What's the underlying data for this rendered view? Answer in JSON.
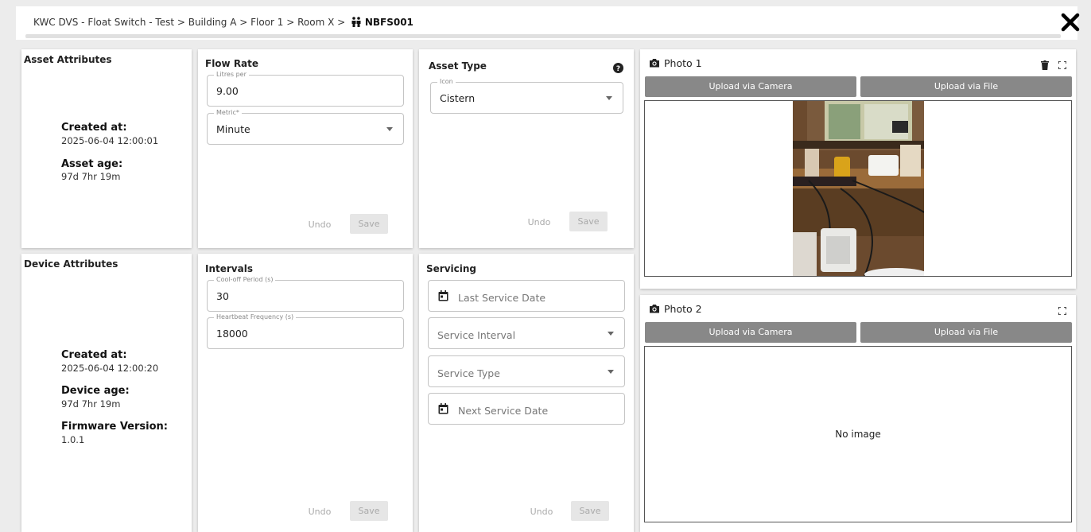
{
  "header": {
    "breadcrumb_path": "KWC DVS - Float Switch - Test > Building A > Floor 1 > Room X >",
    "device_id": "NBFS001",
    "close_icon": "close-icon",
    "device_icon": "people-icon"
  },
  "asset_attributes": {
    "title": "Asset Attributes",
    "created_label": "Created at:",
    "created_value": "2025-06-04 12:00:01",
    "age_label": "Asset age:",
    "age_value": "97d 7hr 19m"
  },
  "device_attributes": {
    "title": "Device Attributes",
    "created_label": "Created at:",
    "created_value": "2025-06-04 12:00:20",
    "age_label": "Device age:",
    "age_value": "97d 7hr 19m",
    "firmware_label": "Firmware Version:",
    "firmware_value": "1.0.1"
  },
  "flow_rate": {
    "title": "Flow Rate",
    "litres_label": "Litres per",
    "litres_value": "9.00",
    "metric_label": "Metric*",
    "metric_value": "Minute",
    "undo_label": "Undo",
    "save_label": "Save"
  },
  "asset_type": {
    "title": "Asset Type",
    "help_icon": "help-icon",
    "icon_label": "Icon",
    "icon_value": "Cistern",
    "undo_label": "Undo",
    "save_label": "Save"
  },
  "intervals": {
    "title": "Intervals",
    "cooloff_label": "Cool-off Period (s)",
    "cooloff_value": "30",
    "heartbeat_label": "Heartbeat Frequency (s)",
    "heartbeat_value": "18000",
    "undo_label": "Undo",
    "save_label": "Save"
  },
  "servicing": {
    "title": "Servicing",
    "last_service_placeholder": "Last Service Date",
    "service_interval_placeholder": "Service Interval",
    "service_type_placeholder": "Service Type",
    "next_service_placeholder": "Next Service Date",
    "undo_label": "Undo",
    "save_label": "Save"
  },
  "photo1": {
    "title": "Photo 1",
    "camera_label": "Upload via Camera",
    "file_label": "Upload via File",
    "camera_icon": "camera-icon",
    "delete_icon": "trash-icon",
    "expand_icon": "expand-icon"
  },
  "photo2": {
    "title": "Photo 2",
    "camera_label": "Upload via Camera",
    "file_label": "Upload via File",
    "empty_text": "No image",
    "camera_icon": "camera-icon",
    "expand_icon": "expand-icon"
  }
}
